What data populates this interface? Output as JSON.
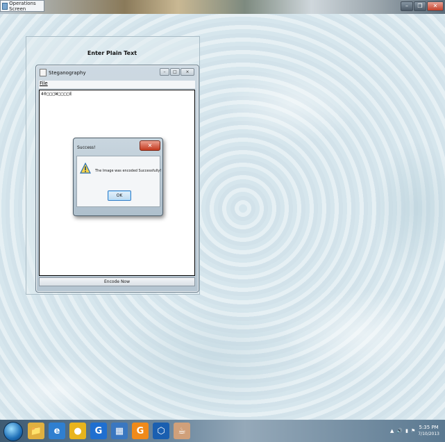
{
  "outer_window": {
    "title": "Operations Screen",
    "minimize_symbol": "–",
    "restore_symbol": "❐",
    "close_symbol": "✕"
  },
  "main_panel": {
    "label": "Enter Plain Text"
  },
  "steg_window": {
    "title": "Steganography",
    "menu_file": "File",
    "text_content": "40□□□W□□□□E",
    "encode_button": "Encode Now",
    "minimize_symbol": "–",
    "maximize_symbol": "□",
    "close_symbol": "⨯"
  },
  "dialog": {
    "title": "Success!",
    "message": "The Image was encoded Successfully!",
    "ok_label": "OK",
    "close_symbol": "✕"
  },
  "taskbar": {
    "time": "5:35 PM",
    "date": "7/10/2013",
    "tray_arrow": "▲",
    "icons": [
      {
        "name": "explorer-icon",
        "glyph": "📁",
        "color": "#e0b040"
      },
      {
        "name": "ie-icon",
        "glyph": "e",
        "color": "#2f7fd0"
      },
      {
        "name": "chrome-icon",
        "glyph": "●",
        "color": "#e8b41c"
      },
      {
        "name": "g-app-icon",
        "glyph": "G",
        "color": "#1f6fd0"
      },
      {
        "name": "calculator-icon",
        "glyph": "▦",
        "color": "#3a77c0"
      },
      {
        "name": "orange-g-icon",
        "glyph": "G",
        "color": "#f08a1a"
      },
      {
        "name": "virtualbox-icon",
        "glyph": "⬡",
        "color": "#1a5fb0"
      },
      {
        "name": "java-icon",
        "glyph": "☕",
        "color": "#d0a07a"
      }
    ]
  }
}
